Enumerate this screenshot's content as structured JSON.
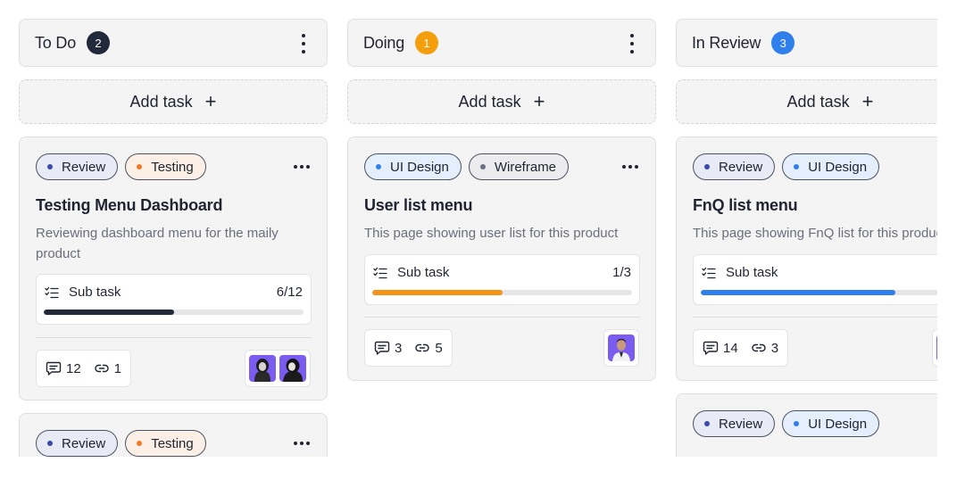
{
  "columns": [
    {
      "title": "To Do",
      "count": "2",
      "count_color": "#22293a",
      "add_label": "Add task",
      "add_icon": "+",
      "cards": [
        {
          "tags": [
            {
              "label": "Review",
              "kind": "review"
            },
            {
              "label": "Testing",
              "kind": "testing"
            }
          ],
          "title": "Testing Menu Dashboard",
          "description": "Reviewing dashboard menu for the maily product",
          "subtask_label": "Sub task",
          "subtask_count": "6/12",
          "progress": 0.5,
          "progress_color": "#22293a",
          "comments": "12",
          "links": "1",
          "avatars": [
            "avatar-woman-1",
            "avatar-woman-2"
          ]
        },
        {
          "tags": [
            {
              "label": "Review",
              "kind": "review"
            },
            {
              "label": "Testing",
              "kind": "testing"
            }
          ]
        }
      ]
    },
    {
      "title": "Doing",
      "count": "1",
      "count_color": "#f59e0b",
      "add_label": "Add task",
      "add_icon": "+",
      "cards": [
        {
          "tags": [
            {
              "label": "UI Design",
              "kind": "uidesign"
            },
            {
              "label": "Wireframe",
              "kind": "wireframe"
            }
          ],
          "title": "User list menu",
          "description": "This page showing user list for this product",
          "subtask_label": "Sub task",
          "subtask_count": "1/3",
          "progress": 0.5,
          "progress_color": "#f59319",
          "comments": "3",
          "links": "5",
          "avatars": [
            "avatar-man-1"
          ]
        }
      ]
    },
    {
      "title": "In Review",
      "count": "3",
      "count_color": "#2f80ed",
      "add_label": "Add task",
      "add_icon": "+",
      "cards": [
        {
          "tags": [
            {
              "label": "Review",
              "kind": "review"
            },
            {
              "label": "UI Design",
              "kind": "uidesign"
            }
          ],
          "title": "FnQ list menu",
          "description": "This page showing FnQ list for this product",
          "subtask_label": "Sub task",
          "subtask_count": "",
          "progress": 0.75,
          "progress_color": "#2f80ed",
          "comments": "14",
          "links": "3",
          "avatars": [
            "avatar-partial"
          ]
        },
        {
          "tags": [
            {
              "label": "Review",
              "kind": "review"
            },
            {
              "label": "UI Design",
              "kind": "uidesign"
            }
          ]
        }
      ]
    }
  ]
}
